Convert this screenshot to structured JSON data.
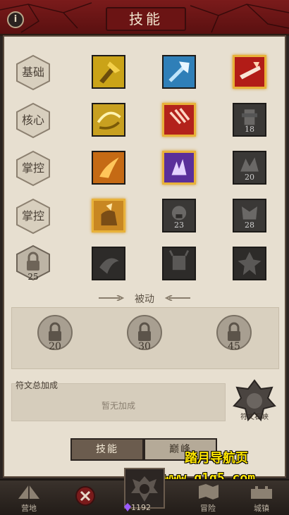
{
  "header": {
    "title": "技能",
    "info_icon": "i"
  },
  "rows": [
    {
      "label": "基础"
    },
    {
      "label": "核心"
    },
    {
      "label": "掌控"
    },
    {
      "label": "掌控"
    },
    {
      "label": "25"
    }
  ],
  "skills": [
    [
      {
        "icon": "golden-axe-icon",
        "active": false,
        "color": "#caa318"
      },
      {
        "icon": "blue-hammer-icon",
        "active": false,
        "color": "#2f7fb8"
      },
      {
        "icon": "red-axe-strike-icon",
        "active": true,
        "color": "#b21c17"
      }
    ],
    [
      {
        "icon": "golden-whirlwind-icon",
        "active": false,
        "color": "#c8a020"
      },
      {
        "icon": "red-claw-icon",
        "active": true,
        "color": "#b3221b"
      },
      {
        "icon": "locked-totem-icon",
        "active": false,
        "lock": "18"
      }
    ],
    [
      {
        "icon": "fire-leap-icon",
        "active": false,
        "color": "#c56a14"
      },
      {
        "icon": "purple-shock-icon",
        "active": true,
        "color": "#5a2f9a"
      },
      {
        "icon": "locked-rock-icon",
        "active": false,
        "lock": "20"
      }
    ],
    [
      {
        "icon": "golden-fist-icon",
        "active": true,
        "color": "#c88722"
      },
      {
        "icon": "locked-roar-icon",
        "active": false,
        "lock": "23"
      },
      {
        "icon": "locked-beast-icon",
        "active": false,
        "lock": "28"
      }
    ],
    [
      {
        "icon": "locked-dragon-icon",
        "active": false
      },
      {
        "icon": "locked-demon-icon",
        "active": false
      },
      {
        "icon": "locked-spike-icon",
        "active": false
      }
    ]
  ],
  "passive": {
    "title": "被动",
    "slots": [
      "20",
      "30",
      "45"
    ]
  },
  "runes": {
    "title": "符文总加成",
    "empty": "暂无加成",
    "emblem_label": "符文石峡"
  },
  "tabs": {
    "skill": "技能",
    "peak": "巅峰"
  },
  "watermark": {
    "line1": "踏月导航页",
    "line2": "www.q1q5.com"
  },
  "bottom_nav": {
    "camp": "营地",
    "gems": "1192",
    "adventure": "冒险",
    "town": "城镇"
  },
  "colors": {
    "header": "#6b1414",
    "gold_border": "#e8b23a",
    "parchment": "#e7dfd0"
  }
}
